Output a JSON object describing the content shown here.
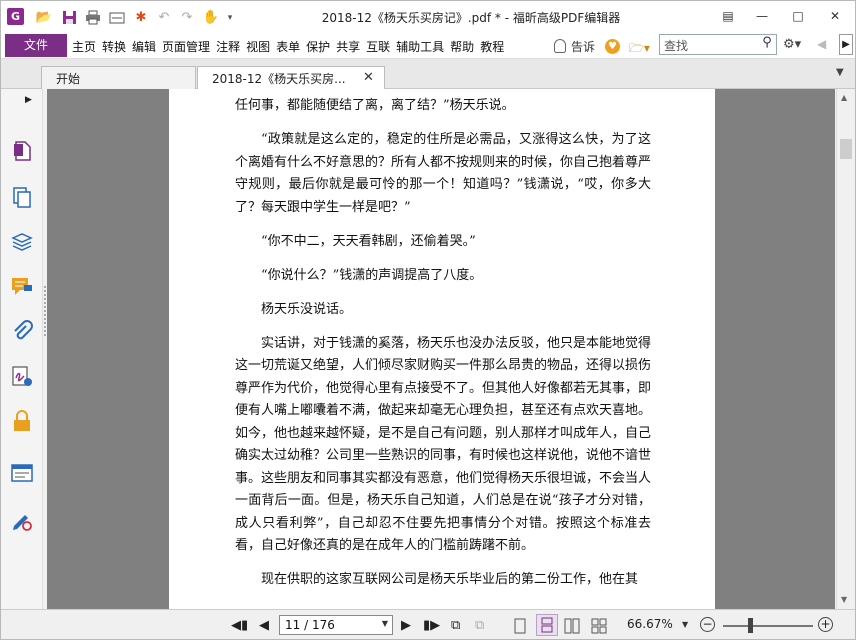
{
  "window": {
    "title": "2018-12《杨天乐买房记》.pdf * - 福昕高级PDF编辑器",
    "app_icon_letter": "G"
  },
  "quick_access": {
    "icons": [
      "open-folder-icon",
      "save-icon",
      "print-icon",
      "scan-icon",
      "new-icon",
      "undo-icon",
      "redo-icon",
      "hand-tool-icon",
      "customize-dropdown-icon"
    ]
  },
  "menu": {
    "file": "文件",
    "items": [
      "主页",
      "转换",
      "编辑",
      "页面管理",
      "注释",
      "视图",
      "表单",
      "保护",
      "共享",
      "互联",
      "辅助工具",
      "帮助",
      "教程"
    ],
    "tell_me": "告诉",
    "search_placeholder": "查找"
  },
  "tabs": [
    {
      "label": "开始"
    },
    {
      "label": "2018-12《杨天乐买房..."
    }
  ],
  "left_panel": {
    "icons": [
      "page-thumbnail-icon",
      "pages-icon",
      "layers-icon",
      "comments-icon",
      "attachments-icon",
      "signature-icon",
      "security-lock-icon",
      "form-fields-icon",
      "certificate-pen-icon"
    ]
  },
  "document": {
    "paragraphs": [
      {
        "indent": false,
        "text": "任何事，都能随便结了离，离了结？”杨天乐说。"
      },
      {
        "indent": true,
        "text": "“政策就是这么定的，稳定的住所是必需品，又涨得这么快，为了这个离婚有什么不好意思的？所有人都不按规则来的时候，你自己抱着尊严守规则，最后你就是最可怜的那一个！知道吗？”钱潇说，“哎，你多大了？每天跟中学生一样是吧？”"
      },
      {
        "indent": true,
        "text": "“你不中二，天天看韩剧，还偷着哭。”"
      },
      {
        "indent": true,
        "text": "“你说什么？”钱潇的声调提高了八度。"
      },
      {
        "indent": true,
        "text": "杨天乐没说话。"
      },
      {
        "indent": true,
        "text": "实话讲，对于钱潇的奚落，杨天乐也没办法反驳，他只是本能地觉得这一切荒诞又绝望，人们倾尽家财购买一件那么昂贵的物品，还得以损伤尊严作为代价，他觉得心里有点接受不了。但其他人好像都若无其事，即便有人嘴上嘟囔着不满，做起来却毫无心理负担，甚至还有点欢天喜地。如今，他也越来越怀疑，是不是自己有问题，别人那样才叫成年人，自己确实太过幼稚？公司里一些熟识的同事，有时候也这样说他，说他不谙世事。这些朋友和同事其实都没有恶意，他们觉得杨天乐很坦诚，不会当人一面背后一面。但是，杨天乐自己知道，人们总是在说“孩子才分对错，成人只看利弊”，自己却忍不住要先把事情分个对错。按照这个标准去看，自己好像还真的是在成年人的门槛前踌躇不前。"
      },
      {
        "indent": true,
        "text": "现在供职的这家互联网公司是杨天乐毕业后的第二份工作，他在其"
      }
    ]
  },
  "status": {
    "page_display": "11 / 176",
    "zoom": "66.67%"
  }
}
